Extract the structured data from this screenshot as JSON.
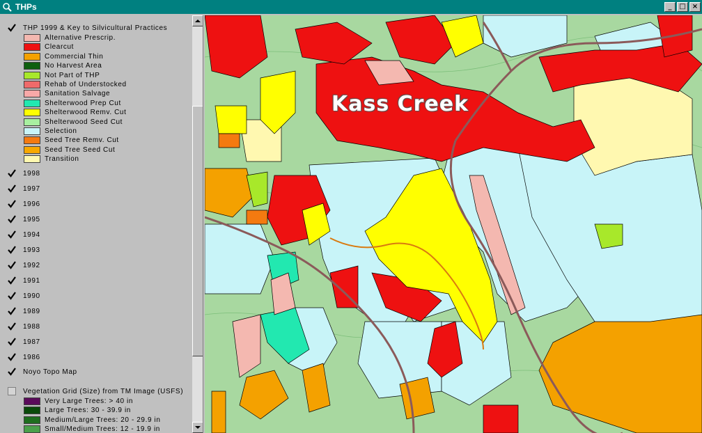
{
  "window": {
    "title": "THPs",
    "minimize_glyph": "_",
    "maximize_glyph": "□",
    "close_glyph": "×"
  },
  "colors": {
    "titlebar": "#008080",
    "map_background": "#a8d8a0"
  },
  "toc": {
    "thp_layer": {
      "name": "THP 1999 & Key to Silvicultural Practices",
      "checked": true,
      "legend": [
        {
          "label": "Alternative Prescrip.",
          "color": "#f4b8b0"
        },
        {
          "label": "Clearcut",
          "color": "#ee1111"
        },
        {
          "label": "Commercial Thin",
          "color": "#f4a100"
        },
        {
          "label": "No Harvest Area",
          "color": "#0e5f0e"
        },
        {
          "label": "Not Part of THP",
          "color": "#a8e82a"
        },
        {
          "label": "Rehab of Understocked",
          "color": "#ef6a6a"
        },
        {
          "label": "Sanitation Salvage",
          "color": "#f8a8a8"
        },
        {
          "label": "Shelterwood Prep Cut",
          "color": "#22e8b0"
        },
        {
          "label": "Shelterwood Remv. Cut",
          "color": "#ffff00"
        },
        {
          "label": "Shelterwood Seed Cut",
          "color": "#a8f0a0"
        },
        {
          "label": "Selection",
          "color": "#c8f4f8"
        },
        {
          "label": "Seed Tree Remv. Cut",
          "color": "#f47a10"
        },
        {
          "label": "Seed Tree Seed Cut",
          "color": "#f8a800"
        },
        {
          "label": "Transition",
          "color": "#fff8b0"
        }
      ]
    },
    "year_layers": [
      {
        "name": "1998",
        "checked": true
      },
      {
        "name": "1997",
        "checked": true
      },
      {
        "name": "1996",
        "checked": true
      },
      {
        "name": "1995",
        "checked": true
      },
      {
        "name": "1994",
        "checked": true
      },
      {
        "name": "1993",
        "checked": true
      },
      {
        "name": "1992",
        "checked": true
      },
      {
        "name": "1991",
        "checked": true
      },
      {
        "name": "1990",
        "checked": true
      },
      {
        "name": "1989",
        "checked": true
      },
      {
        "name": "1988",
        "checked": true
      },
      {
        "name": "1987",
        "checked": true
      },
      {
        "name": "1986",
        "checked": true
      }
    ],
    "topo_layer": {
      "name": "Noyo Topo Map",
      "checked": true
    },
    "veg_layer": {
      "name": "Vegetation Grid (Size) from TM Image (USFS)",
      "checked": false,
      "legend": [
        {
          "label": "Very Large Trees: > 40  in",
          "color": "#5a0a5a"
        },
        {
          "label": "Large Trees: 30 - 39.9 in",
          "color": "#0a4a0a"
        },
        {
          "label": "Medium/Large Trees: 20 - 29.9 in",
          "color": "#1e6e1e"
        },
        {
          "label": "Small/Medium Trees: 12 - 19.9 in",
          "color": "#4aa04a"
        }
      ]
    }
  },
  "map": {
    "place_label": "Kass Creek"
  }
}
